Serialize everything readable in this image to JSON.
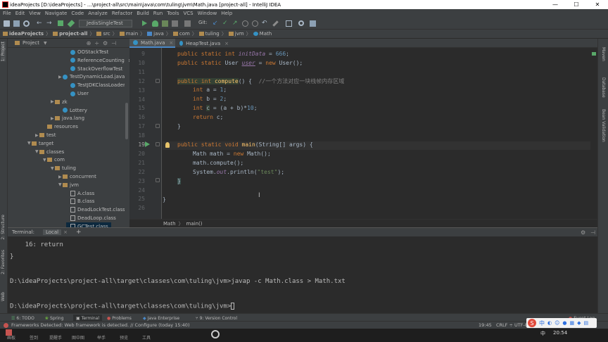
{
  "window": {
    "title": "ideaProjects [D:\\ideaProjects] - ...\\project-all\\src\\main\\java\\com\\tuling\\jvm\\Math.java [project-all] - IntelliJ IDEA",
    "minimize": "—",
    "maximize": "☐",
    "close": "✕"
  },
  "menu": [
    "File",
    "Edit",
    "View",
    "Navigate",
    "Code",
    "Analyze",
    "Refactor",
    "Build",
    "Run",
    "Tools",
    "VCS",
    "Window",
    "Help"
  ],
  "toolbar": {
    "run_config": "JedisSingleTest",
    "git_label": "Git:"
  },
  "breadcrumbs": [
    "ideaProjects",
    "project-all",
    "src",
    "main",
    "java",
    "com",
    "tuling",
    "jvm",
    "Math"
  ],
  "project_panel": {
    "title": "Project",
    "tree": [
      {
        "label": "OOStackTest",
        "type": "class",
        "depth": 7,
        "arrow": ""
      },
      {
        "label": "ReferenceCountingGc",
        "type": "class",
        "depth": 7,
        "arrow": ""
      },
      {
        "label": "StackOverflowTest",
        "type": "class",
        "depth": 7,
        "arrow": ""
      },
      {
        "label": "TestDynamicLoad.java",
        "type": "java",
        "depth": 6,
        "arrow": "▶"
      },
      {
        "label": "TestJDKClassLoader",
        "type": "class",
        "depth": 7,
        "arrow": ""
      },
      {
        "label": "User",
        "type": "class",
        "depth": 7,
        "arrow": ""
      },
      {
        "label": "zk",
        "type": "folder",
        "depth": 5,
        "arrow": "▶"
      },
      {
        "label": "Lottery",
        "type": "class",
        "depth": 6,
        "arrow": ""
      },
      {
        "label": "java.lang",
        "type": "folder",
        "depth": 5,
        "arrow": "▶"
      },
      {
        "label": "resources",
        "type": "folder",
        "depth": 4,
        "arrow": ""
      },
      {
        "label": "test",
        "type": "folder",
        "depth": 3,
        "arrow": "▶"
      },
      {
        "label": "target",
        "type": "ofolder",
        "depth": 2,
        "arrow": "▼"
      },
      {
        "label": "classes",
        "type": "ofolder",
        "depth": 3,
        "arrow": "▼"
      },
      {
        "label": "com",
        "type": "ofolder",
        "depth": 4,
        "arrow": "▼"
      },
      {
        "label": "tuling",
        "type": "ofolder",
        "depth": 5,
        "arrow": "▼"
      },
      {
        "label": "concurrent",
        "type": "ofolder",
        "depth": 6,
        "arrow": "▶"
      },
      {
        "label": "jvm",
        "type": "ofolder",
        "depth": 6,
        "arrow": "▼"
      },
      {
        "label": "A.class",
        "type": "file",
        "depth": 7,
        "arrow": ""
      },
      {
        "label": "B.class",
        "type": "file",
        "depth": 7,
        "arrow": ""
      },
      {
        "label": "DeadLockTest.class",
        "type": "file",
        "depth": 7,
        "arrow": ""
      },
      {
        "label": "DeadLoop.class",
        "type": "file",
        "depth": 7,
        "arrow": ""
      },
      {
        "label": "GCTest.class",
        "type": "file",
        "depth": 7,
        "arrow": ""
      }
    ]
  },
  "editor": {
    "tabs": [
      "Math.java",
      "HeapTest.java"
    ],
    "line_numbers": [
      "9",
      "10",
      "11",
      "12",
      "13",
      "14",
      "15",
      "16",
      "17",
      "18",
      "19",
      "20",
      "21",
      "22",
      "23",
      "24",
      "25",
      "26"
    ],
    "code": {
      "l9_a": "public static int ",
      "l9_b": "initData",
      "l9_c": " = ",
      "l9_d": "666",
      "l9_e": ";",
      "l10_a": "public static ",
      "l10_b": "User ",
      "l10_c": "user",
      "l10_d": " = ",
      "l10_e": "new ",
      "l10_f": "User();",
      "l12_a": "public int ",
      "l12_b": "compute",
      "l12_c": "() {  ",
      "l12_d": "//一个方法对应一块栈帧内存区域",
      "l13_a": "int ",
      "l13_b": "a = ",
      "l13_c": "1",
      "l13_d": ";",
      "l14_a": "int ",
      "l14_b": "b = ",
      "l14_c": "2",
      "l14_d": ";",
      "l15_a": "int ",
      "l15_b": "c",
      "l15_c": " = (a + b)*",
      "l15_d": "10",
      "l15_e": ";",
      "l16_a": "return ",
      "l16_b": "c;",
      "l17": "}",
      "l19_a": "public static void ",
      "l19_b": "main",
      "l19_c": "(String[] args) {",
      "l20_a": "Math math = ",
      "l20_b": "new ",
      "l20_c": "Math();",
      "l21": "math.compute();",
      "l22_a": "System.",
      "l22_b": "out",
      "l22_c": ".println(",
      "l22_d": "\"test\"",
      "l22_e": ");",
      "l23": "}",
      "l25": "}"
    },
    "breadcrumb": [
      "Math",
      "main()"
    ]
  },
  "terminal": {
    "title": "Terminal:",
    "tab": "Local",
    "add": "+",
    "lines": [
      "    16: return",
      "}",
      "",
      "D:\\ideaProjects\\project-all\\target\\classes\\com\\tuling\\jvm>javap -c Math.class > Math.txt",
      "",
      "D:\\ideaProjects\\project-all\\target\\classes\\com\\tuling\\jvm>"
    ]
  },
  "bottom_tabs": [
    "6: TODO",
    "Spring",
    "Terminal",
    "Problems",
    "Java Enterprise",
    "9: Version Control"
  ],
  "event_log": "Event Log",
  "status": {
    "message": "Frameworks Detected: Web framework is detected. // Configure (today 15:40)",
    "position": "19:45",
    "line_sep": "CRLF ÷",
    "encoding": "UTF-8"
  },
  "left_strip": [
    "1: Project",
    "2: Structure",
    "2: Favorites",
    "Web"
  ],
  "right_strip": [
    "Maven",
    "Database",
    "Bean Validation"
  ],
  "player": {
    "items": [
      "画板",
      "签到",
      "提醒手",
      "图中图",
      "举手",
      "预览",
      "工具"
    ],
    "time": "20:54",
    "lang": "中"
  },
  "colors": {
    "accent_blue": "#4a88c7",
    "run_green": "#59a869",
    "error_red": "#c75450"
  }
}
